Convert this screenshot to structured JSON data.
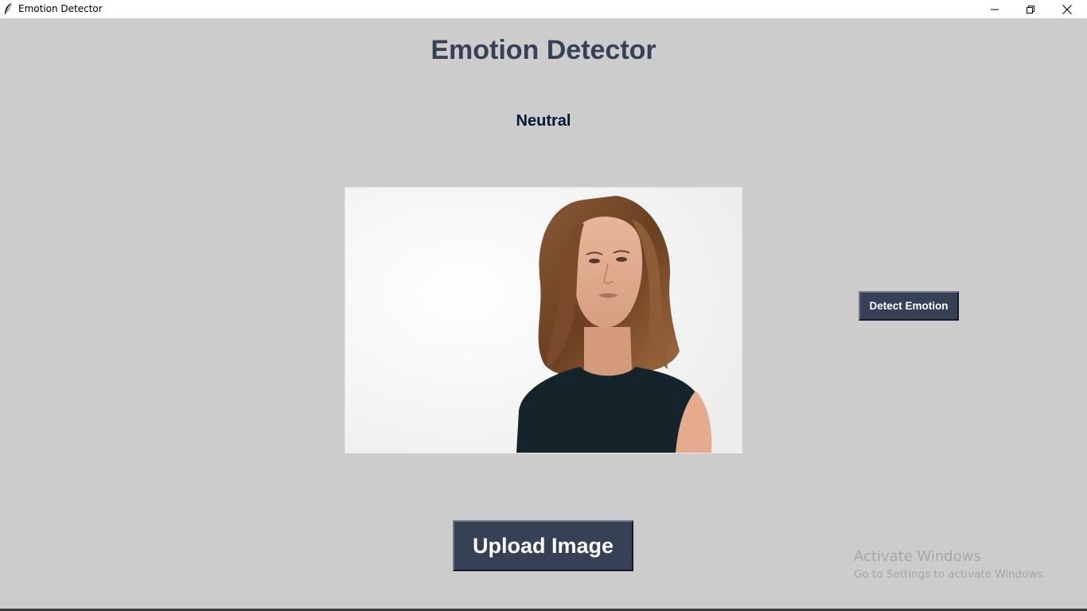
{
  "window": {
    "title": "Emotion Detector",
    "app_icon": "feather-icon",
    "controls": [
      "minimize-icon",
      "restore-icon",
      "close-icon"
    ]
  },
  "app": {
    "heading": "Emotion Detector",
    "result": "Neutral",
    "detect_button_label": "Detect Emotion",
    "upload_button_label": "Upload Image",
    "image_alt": "Portrait of a woman with shoulder-length brown hair wearing a dark sleeveless top"
  },
  "watermark": {
    "title": "Activate Windows",
    "subtitle": "Go to Settings to activate Windows."
  },
  "colors": {
    "background": "#cccccc",
    "button_bg": "#364156",
    "button_text": "#ffffff",
    "heading": "#364156",
    "result_text": "#011638"
  }
}
